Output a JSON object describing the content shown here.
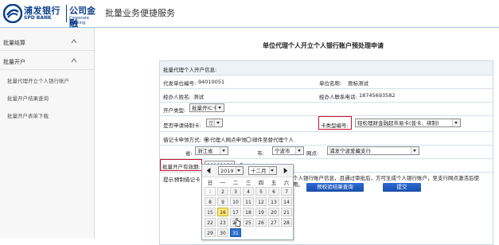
{
  "header": {
    "bank_name_cn": "浦发银行",
    "bank_name_en": "SPD BANK",
    "corp_cn": "公司金融",
    "corp_en": "Corporate Banking",
    "app_title": "批量业务便捷服务"
  },
  "sidebar": {
    "groups": [
      {
        "label": "批量结算"
      },
      {
        "label": "批量开户"
      }
    ],
    "items": [
      {
        "label": "批量代理开立个人银行账户"
      },
      {
        "label": "批量开户结果查询"
      },
      {
        "label": "批量开户表单下载"
      }
    ]
  },
  "page_title": "单位代理个人开立个人银行账户预处理申请",
  "form": {
    "section_title": "批量代理个人开户信息:",
    "agent_unit_code_label": "代发单位编号:",
    "agent_unit_code_value": "94010051",
    "unit_name_label": "单位名称:",
    "unit_name_value": "贾标测试",
    "handler_name_label": "经办人姓名:",
    "handler_name_value": "测试",
    "handler_phone_label": "经办人联系电话:",
    "handler_phone_value": "18745693582",
    "open_type_label": "开户类型:",
    "open_type_value": "批量开IC卡",
    "apply_card_label": "是否申请待制卡:",
    "apply_card_value": "是",
    "card_type_label": "卡类型编号:",
    "card_type_value": "轻松理财金融超市易卡(普卡、绑制)",
    "delivery_label": "借记卡申领方式:",
    "delivery_option1": "代理人网点申领",
    "delivery_option2": "邮件至替代理个人",
    "province_label": "省:",
    "province_value": "浙江省",
    "city_label": "市:",
    "city_value": "宁波市",
    "branch_label": "网点:",
    "branch_value": "浦发宁波爱藏支行",
    "valid_date_label": "批量开户有效期:",
    "valid_date_value": "20191231",
    "tip_label": "提示:",
    "tip_prefix": "预制借记卡",
    "tip_text": "个人银行账户信息，且通过审批后，方可生成个人银行账户，至支行网点激活后使用。",
    "button_query": "预校验结果查询",
    "button_submit": "提交"
  },
  "calendar": {
    "year": "2019",
    "month": "十二月",
    "weekdays": [
      "日",
      "一",
      "二",
      "三",
      "四",
      "五",
      "六"
    ],
    "days": [
      {
        "d": "1",
        "muted": true
      },
      {
        "d": "2",
        "muted": false
      },
      {
        "d": "3",
        "muted": false
      },
      {
        "d": "4",
        "muted": false
      },
      {
        "d": "5",
        "muted": false
      },
      {
        "d": "6",
        "muted": false
      },
      {
        "d": "7",
        "muted": false
      },
      {
        "d": "8",
        "muted": false
      },
      {
        "d": "9",
        "muted": false
      },
      {
        "d": "10",
        "muted": false
      },
      {
        "d": "11",
        "muted": false
      },
      {
        "d": "12",
        "muted": false
      },
      {
        "d": "13",
        "muted": false
      },
      {
        "d": "14",
        "muted": false
      },
      {
        "d": "15",
        "muted": false
      },
      {
        "d": "16",
        "today": true
      },
      {
        "d": "17",
        "muted": false
      },
      {
        "d": "18",
        "muted": false
      },
      {
        "d": "19",
        "muted": false
      },
      {
        "d": "20",
        "muted": false
      },
      {
        "d": "21",
        "muted": false
      },
      {
        "d": "22",
        "muted": false
      },
      {
        "d": "23",
        "muted": false
      },
      {
        "d": "24",
        "muted": false
      },
      {
        "d": "25",
        "muted": false
      },
      {
        "d": "26",
        "muted": false
      },
      {
        "d": "27",
        "muted": false
      },
      {
        "d": "28",
        "muted": false
      },
      {
        "d": "29",
        "muted": false
      },
      {
        "d": "30",
        "muted": false
      },
      {
        "d": "31",
        "selected": true
      }
    ]
  },
  "colors": {
    "brand": "#0a3f8c",
    "highlight_border": "#c8102e",
    "button": "#2f6bd6",
    "today": "#ffe97a",
    "selected_day": "#2a6fd1"
  }
}
